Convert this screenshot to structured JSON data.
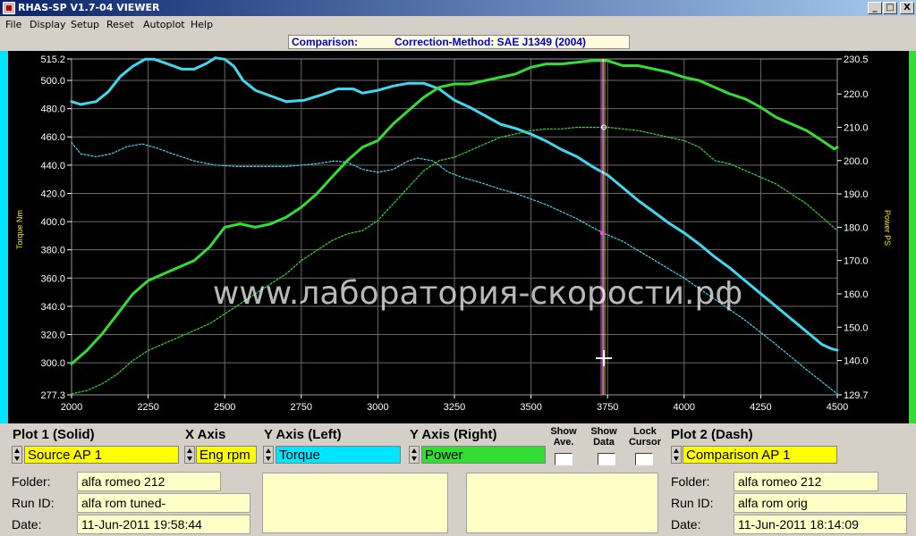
{
  "window": {
    "title": "RHAS-SP V1.7-04  VIEWER",
    "buttons": [
      "_",
      "□",
      "X"
    ]
  },
  "menu": [
    "File",
    "Display",
    "Setup",
    "Reset",
    "Autoplot",
    "Help"
  ],
  "header": {
    "comparison_label": "Comparison:",
    "method_label": "Correction-Method: SAE J1349 (2004)"
  },
  "watermark": "www.лаборатория-скорости.рф",
  "chart_data": {
    "type": "line",
    "x_ticks": [
      "2000",
      "2250",
      "2500",
      "2750",
      "3000",
      "3250",
      "3500",
      "3750",
      "4000",
      "4250",
      "4500"
    ],
    "xlim": [
      2000,
      4500
    ],
    "left_axis": {
      "label": "Torque Nm",
      "ylim": [
        277.3,
        515.2
      ],
      "tick_labels": [
        "515.2",
        "500.0",
        "480.0",
        "460.0",
        "440.0",
        "420.0",
        "400.0",
        "380.0",
        "360.0",
        "340.0",
        "320.0",
        "300.0",
        "277.3"
      ],
      "tick_values": [
        515.2,
        500,
        480,
        460,
        440,
        420,
        400,
        380,
        360,
        340,
        320,
        300,
        277.3
      ]
    },
    "right_axis": {
      "label": "Power PS",
      "ylim": [
        129.7,
        230.5
      ],
      "tick_labels": [
        "230.5",
        "220.0",
        "210.0",
        "200.0",
        "190.0",
        "180.0",
        "170.0",
        "160.0",
        "150.0",
        "140.0",
        "129.7"
      ],
      "tick_values": [
        230.5,
        220,
        210,
        200,
        190,
        180,
        170,
        160,
        150,
        140,
        129.7
      ]
    },
    "cursor_rpm": 3735,
    "grid": true,
    "series": [
      {
        "axis": "left",
        "style": "solid",
        "color": "#40d8f0",
        "x": [
          2000,
          2030,
          2080,
          2120,
          2160,
          2200,
          2240,
          2270,
          2310,
          2360,
          2400,
          2440,
          2470,
          2500,
          2530,
          2560,
          2600,
          2650,
          2700,
          2760,
          2820,
          2870,
          2920,
          2950,
          3000,
          3050,
          3100,
          3150,
          3200,
          3250,
          3300,
          3350,
          3400,
          3450,
          3500,
          3550,
          3600,
          3650,
          3700,
          3750,
          3800,
          3850,
          3900,
          3950,
          4000,
          4050,
          4100,
          4150,
          4200,
          4250,
          4300,
          4350,
          4400,
          4450,
          4480,
          4500
        ],
        "y": [
          485,
          483,
          485,
          492,
          503,
          510,
          515,
          515,
          512,
          508,
          508,
          512,
          516,
          515,
          510,
          500,
          493,
          489,
          485,
          486,
          490,
          494,
          494,
          491,
          493,
          496,
          498,
          498,
          494,
          486,
          481,
          475,
          469,
          466,
          462,
          457,
          451,
          446,
          439,
          433,
          424,
          415,
          407,
          399,
          392,
          384,
          375,
          367,
          358,
          349,
          340,
          331,
          322,
          313,
          310,
          309
        ]
      },
      {
        "axis": "left",
        "style": "dash",
        "color": "#40d8f0",
        "x": [
          2000,
          2030,
          2080,
          2130,
          2180,
          2230,
          2280,
          2330,
          2400,
          2470,
          2540,
          2620,
          2700,
          2800,
          2860,
          2900,
          2950,
          3000,
          3050,
          3100,
          3130,
          3180,
          3230,
          3280,
          3330,
          3400,
          3450,
          3500,
          3550,
          3600,
          3650,
          3700,
          3735,
          3800,
          3900,
          4000,
          4100,
          4200,
          4300,
          4400,
          4500
        ],
        "y": [
          456,
          448,
          446,
          448,
          453,
          455,
          452,
          448,
          443,
          440,
          439,
          439,
          439,
          441,
          443,
          442,
          437,
          435,
          437,
          443,
          445,
          443,
          435,
          431,
          428,
          423,
          420,
          416,
          412,
          407,
          402,
          396,
          392,
          386,
          373,
          360,
          345,
          330,
          313,
          295,
          278
        ]
      },
      {
        "axis": "right",
        "style": "solid",
        "color": "#33dd33",
        "x": [
          2000,
          2050,
          2100,
          2150,
          2200,
          2250,
          2300,
          2350,
          2400,
          2450,
          2500,
          2550,
          2600,
          2650,
          2700,
          2750,
          2800,
          2850,
          2900,
          2950,
          3000,
          3050,
          3100,
          3150,
          3200,
          3250,
          3300,
          3350,
          3400,
          3450,
          3500,
          3550,
          3600,
          3650,
          3700,
          3750,
          3800,
          3850,
          3900,
          3950,
          4000,
          4050,
          4100,
          4150,
          4200,
          4250,
          4300,
          4350,
          4400,
          4450,
          4490,
          4500
        ],
        "y": [
          139,
          143,
          148,
          154,
          160,
          164,
          166,
          168,
          170,
          174,
          180,
          181,
          180,
          181,
          183,
          186,
          190,
          195,
          200,
          204,
          206,
          211,
          215,
          219,
          222,
          223,
          223,
          224,
          225,
          226,
          228,
          229,
          229,
          229.5,
          230,
          230,
          228.5,
          228.5,
          227.5,
          226.5,
          225,
          224,
          222,
          220,
          218.5,
          216,
          213,
          211,
          209,
          206,
          203.5,
          204
        ]
      },
      {
        "axis": "right",
        "style": "dash",
        "color": "#33dd33",
        "x": [
          2000,
          2050,
          2100,
          2150,
          2200,
          2250,
          2300,
          2350,
          2400,
          2450,
          2500,
          2550,
          2600,
          2650,
          2700,
          2750,
          2800,
          2850,
          2900,
          2950,
          3000,
          3050,
          3100,
          3150,
          3200,
          3250,
          3300,
          3350,
          3400,
          3450,
          3500,
          3550,
          3600,
          3650,
          3700,
          3750,
          3800,
          3850,
          3900,
          3950,
          4000,
          4050,
          4100,
          4150,
          4200,
          4250,
          4300,
          4350,
          4400,
          4450,
          4500
        ],
        "y": [
          130,
          131,
          133,
          136,
          140,
          143,
          145,
          147,
          149,
          151,
          154,
          157,
          160,
          163,
          166,
          170,
          173,
          176,
          178,
          179,
          182,
          187,
          192,
          197,
          200,
          201,
          203,
          205,
          207,
          208,
          209,
          209.5,
          209.5,
          210,
          210,
          210,
          209.5,
          209,
          208,
          207,
          206,
          204,
          200,
          199,
          197,
          195,
          193,
          190,
          187,
          183,
          179
        ]
      }
    ]
  },
  "panel": {
    "plot1_title": "Plot 1 (Solid)",
    "xaxis_title": "X Axis",
    "yleft_title": "Y Axis (Left)",
    "yright_title": "Y Axis (Right)",
    "show_ave_label": "Show Ave.",
    "show_data_label": "Show Data",
    "lock_cursor_label": "Lock Cursor",
    "plot2_title": "Plot 2 (Dash)",
    "plot1_source": "Source AP 1",
    "xaxis_value": "Eng rpm",
    "yleft_value": "Torque",
    "yright_value": "Power",
    "plot2_source": "Comparison AP 1",
    "folder_label": "Folder:",
    "runid_label": "Run ID:",
    "date_label": "Date:",
    "plot1_folder": "alfa romeo 212",
    "plot1_runid": "alfa rom tuned-",
    "plot1_date": "11-Jun-2011  19:58:44",
    "plot2_folder": "alfa romeo 212",
    "plot2_runid": "alfa rom orig",
    "plot2_date": "11-Jun-2011  18:14:09",
    "colors": {
      "plot1": "#ffff00",
      "xaxis": "#ffff00",
      "yleft": "#00e5ff",
      "yright": "#33dd33",
      "plot2": "#ffff00"
    }
  }
}
